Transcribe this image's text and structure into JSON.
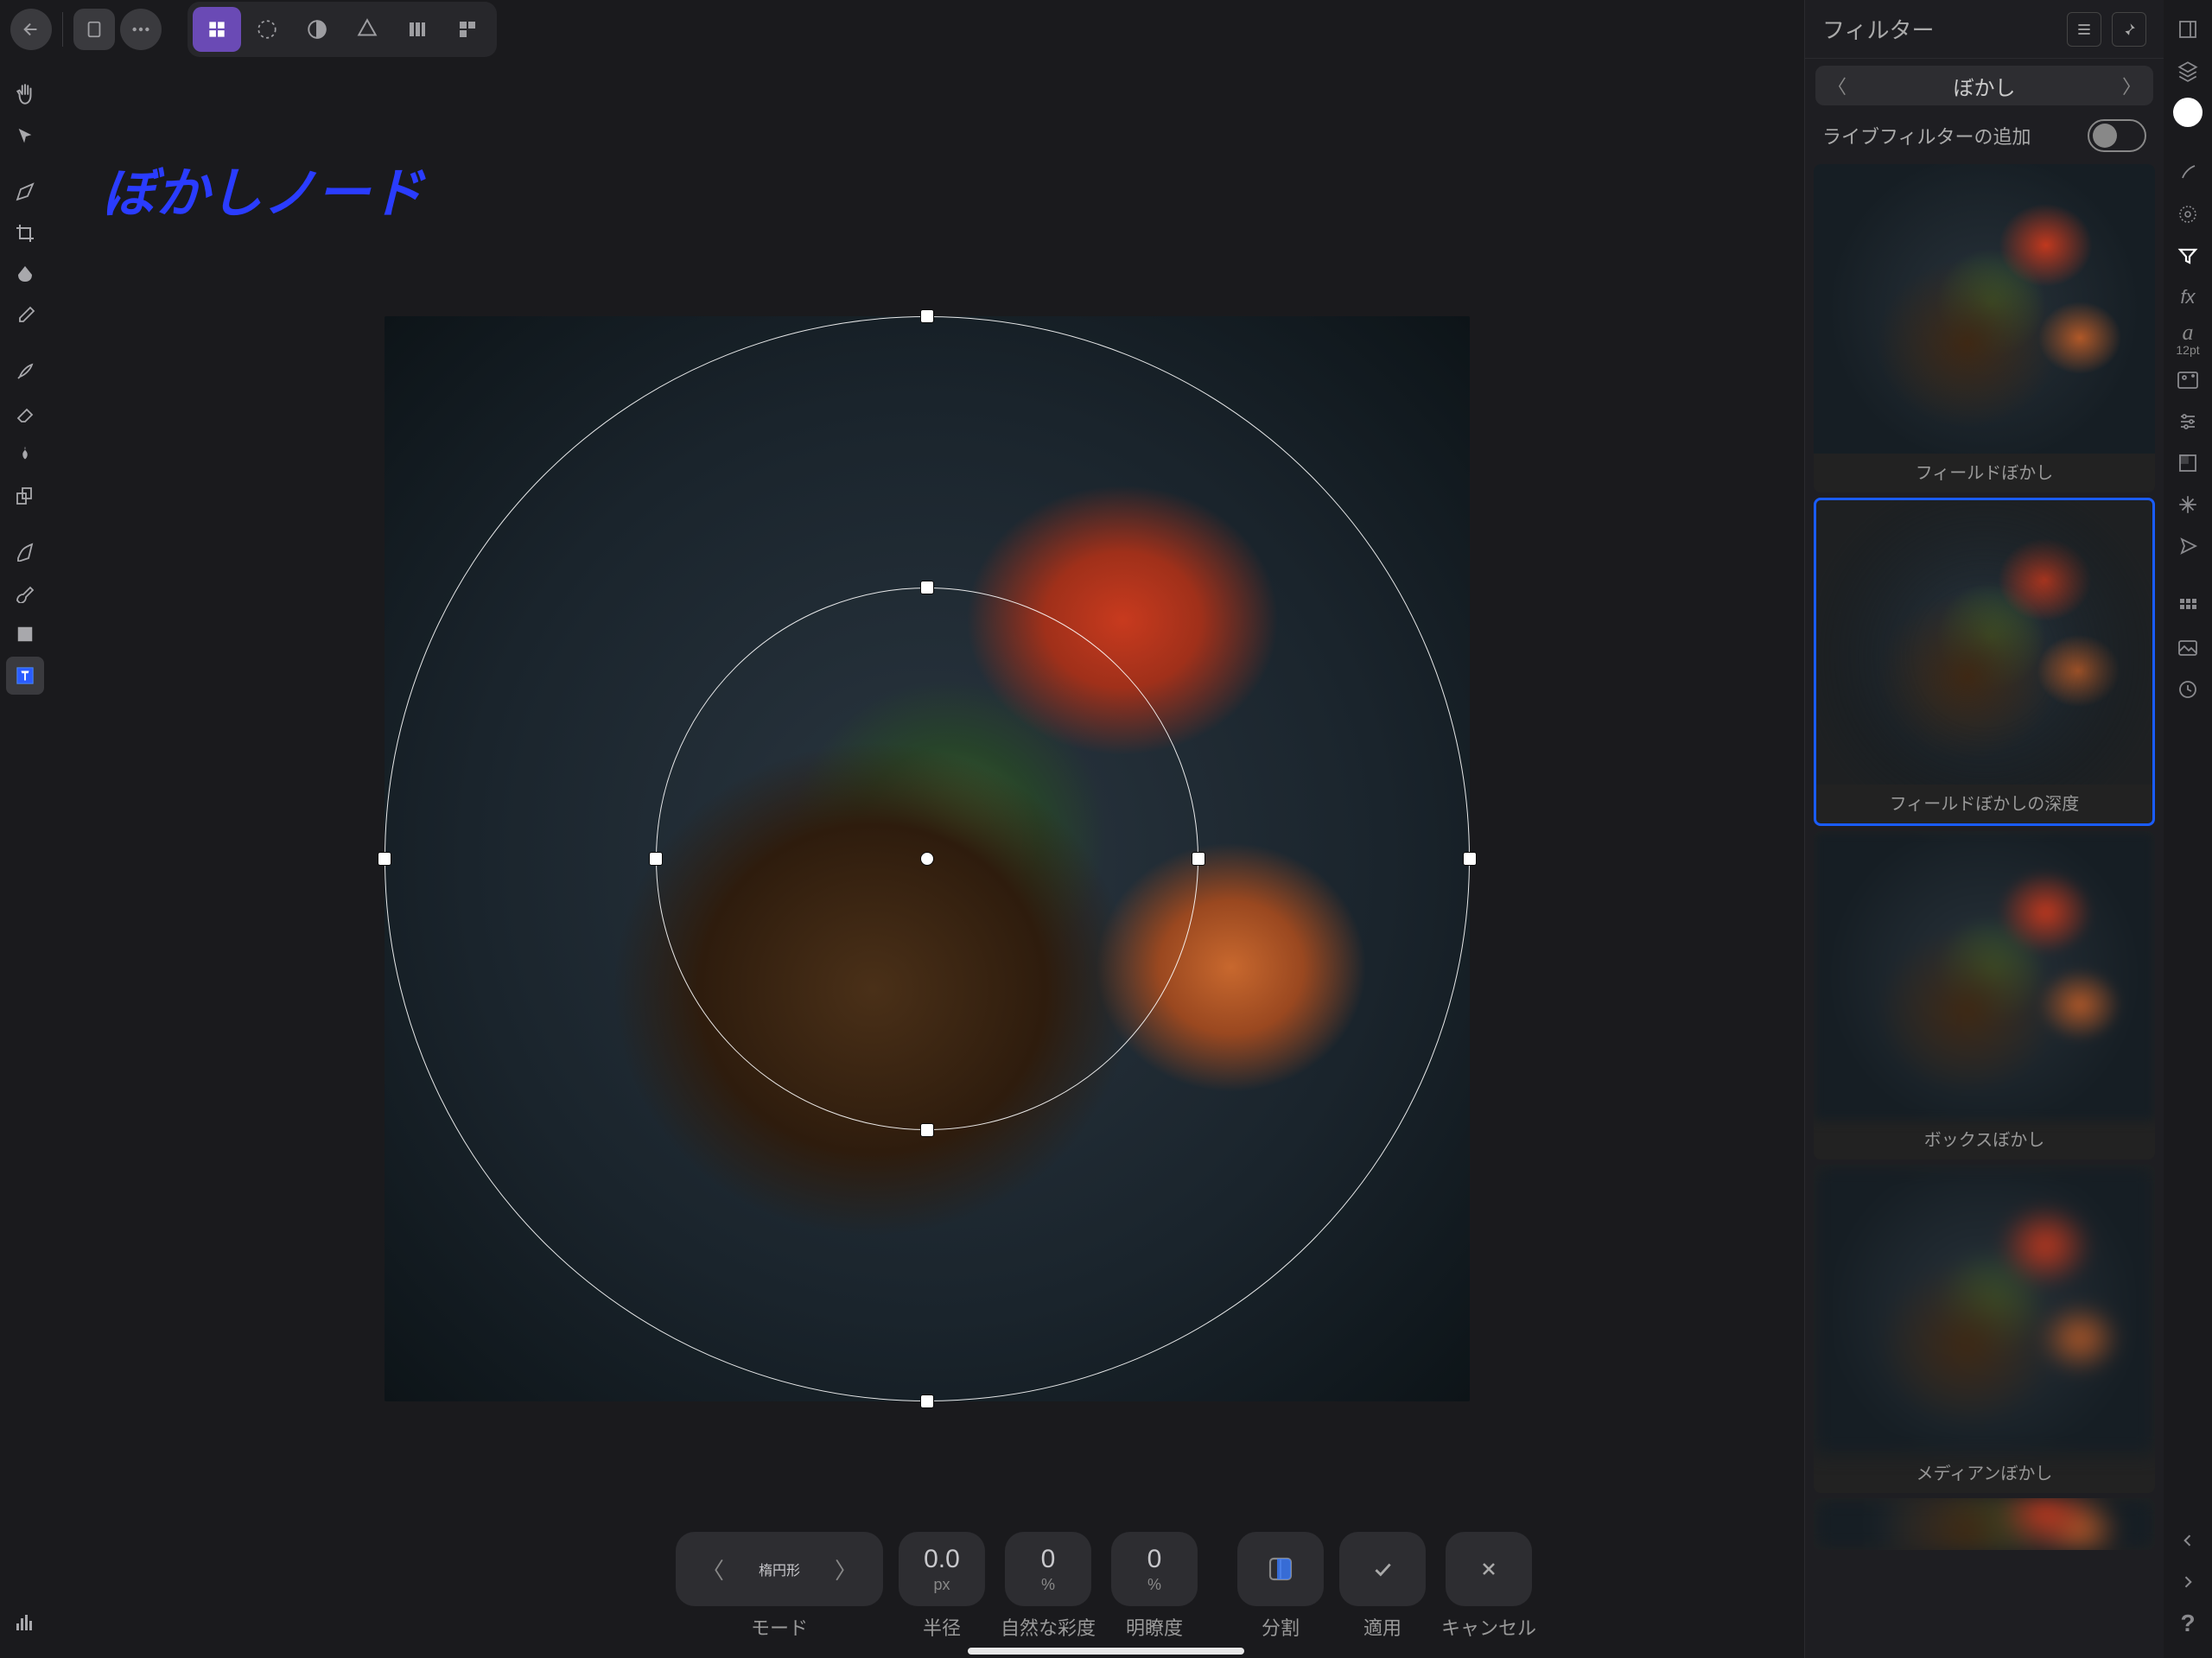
{
  "annotation": "ぼかしノード",
  "topbar": {
    "back": "←"
  },
  "panel": {
    "title": "フィルター",
    "category": "ぼかし",
    "addLive": "ライブフィルターの追加"
  },
  "filters": [
    {
      "label": "フィールドぼかし",
      "selected": false,
      "blur": ""
    },
    {
      "label": "フィールドぼかしの深度",
      "selected": true,
      "blur": "dof"
    },
    {
      "label": "ボックスぼかし",
      "selected": false,
      "blur": "blur"
    },
    {
      "label": "メディアンぼかし",
      "selected": false,
      "blur": "blur2"
    }
  ],
  "bottom": {
    "mode": {
      "value": "楕円形",
      "label": "モード"
    },
    "radius": {
      "value": "0.0",
      "unit": "px",
      "label": "半径"
    },
    "vibrance": {
      "value": "0",
      "unit": "%",
      "label": "自然な彩度"
    },
    "clarity": {
      "value": "0",
      "unit": "%",
      "label": "明瞭度"
    },
    "split": {
      "label": "分割"
    },
    "apply": {
      "label": "適用"
    },
    "cancel": {
      "label": "キャンセル"
    }
  },
  "rightTypo": {
    "glyph": "a",
    "size": "12pt"
  }
}
